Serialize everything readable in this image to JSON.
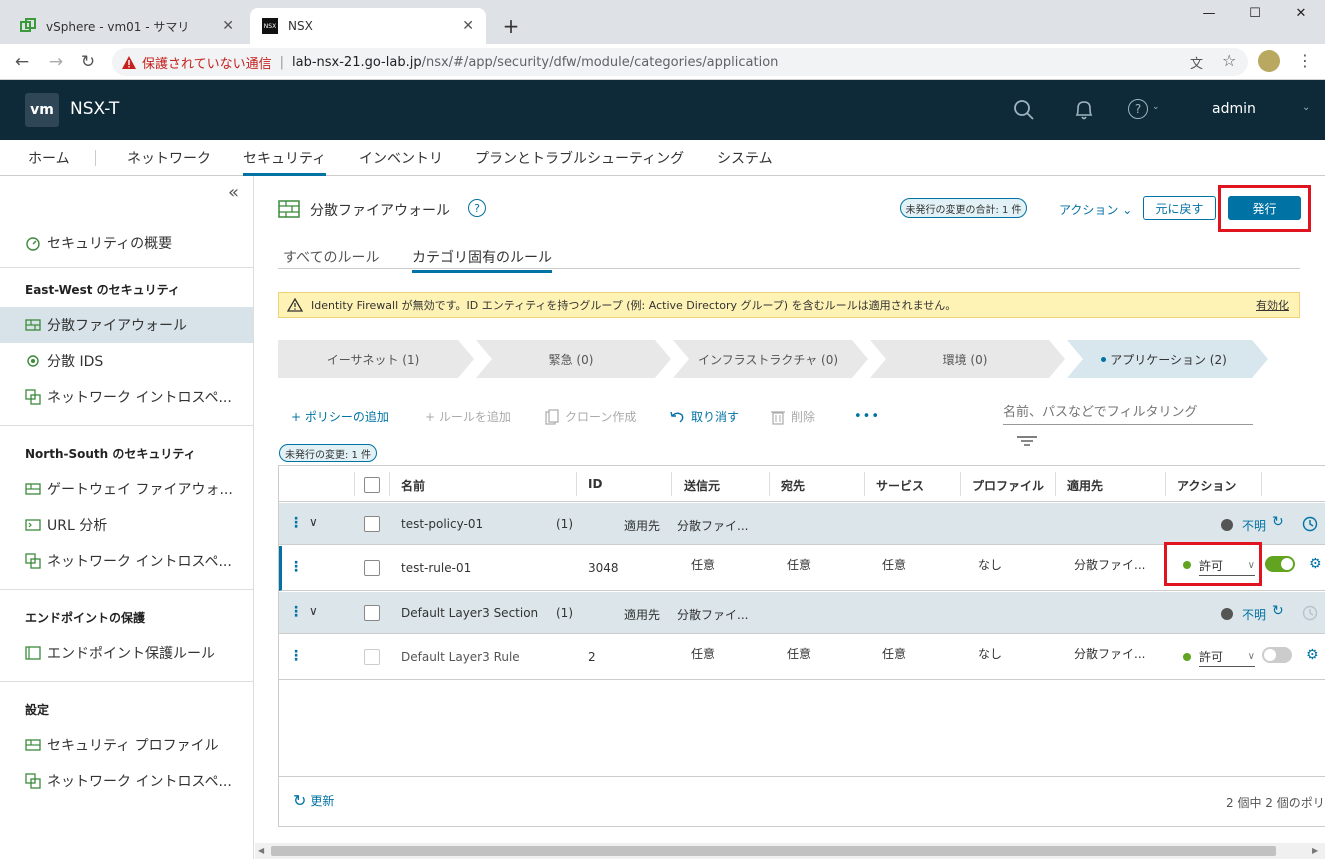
{
  "browser": {
    "tabs": [
      {
        "title": "vSphere - vm01 - サマリ",
        "active": false
      },
      {
        "title": "NSX",
        "active": true
      }
    ],
    "security_warning": "保護されていない通信",
    "url_host": "lab-nsx-21.go-lab.jp",
    "url_path": "/nsx/#/app/security/dfw/module/categories/application"
  },
  "header": {
    "logo": "vm",
    "title": "NSX-T",
    "user": "admin"
  },
  "main_nav": [
    "ホーム",
    "ネットワーク",
    "セキュリティ",
    "インベントリ",
    "プランとトラブルシューティング",
    "システム"
  ],
  "sidebar": {
    "collapse": "«",
    "overview": "セキュリティの概要",
    "east_west_heading": "East-West のセキュリティ",
    "east_west_items": [
      "分散ファイアウォール",
      "分散 IDS",
      "ネットワーク イントロスペ..."
    ],
    "north_south_heading": "North-South のセキュリティ",
    "north_south_items": [
      "ゲートウェイ ファイアウォ...",
      "URL 分析",
      "ネットワーク イントロスペ..."
    ],
    "endpoint_heading": "エンドポイントの保護",
    "endpoint_items": [
      "エンドポイント保護ルール"
    ],
    "settings_heading": "設定",
    "settings_items": [
      "セキュリティ プロファイル",
      "ネットワーク イントロスペ..."
    ]
  },
  "page": {
    "title": "分散ファイアウォール",
    "help": "?",
    "unpublished_total": "未発行の変更の合計: 1 件",
    "actions": "アクション",
    "revert": "元に戻す",
    "publish": "発行",
    "tabs": [
      "すべてのルール",
      "カテゴリ固有のルール"
    ],
    "alert_text": "Identity Firewall が無効です。ID エンティティを持つグループ (例: Active Directory グループ) を含むルールは適用されません。",
    "alert_link": "有効化",
    "categories": [
      "イーサネット (1)",
      "緊急 (0)",
      "インフラストラクチャ (0)",
      "環境 (0)",
      "アプリケーション (2)"
    ],
    "toolbar": {
      "add_policy": "+ ポリシーの追加",
      "add_rule": "+ ルールを追加",
      "clone": "クローン作成",
      "undo": "取り消す",
      "delete": "削除",
      "more": "•••",
      "filter_placeholder": "名前、パスなどでフィルタリング"
    },
    "unpublished_badge": "未発行の変更: 1 件",
    "columns": [
      "名前",
      "ID",
      "送信元",
      "宛先",
      "サービス",
      "プロファイル",
      "適用先",
      "アクション"
    ],
    "policies": [
      {
        "name": "test-policy-01",
        "count": "(1)",
        "applied_label": "適用先",
        "applied_to": "分散ファイ...",
        "status": "不明",
        "rule": {
          "name": "test-rule-01",
          "id": "3048",
          "source": "任意",
          "destination": "任意",
          "service": "任意",
          "profile": "なし",
          "applied_to": "分散ファイ...",
          "action": "許可",
          "enabled": true
        }
      },
      {
        "name": "Default Layer3 Section",
        "count": "(1)",
        "applied_label": "適用先",
        "applied_to": "分散ファイ...",
        "status": "不明",
        "rule": {
          "name": "Default Layer3 Rule",
          "id": "2",
          "source": "任意",
          "destination": "任意",
          "service": "任意",
          "profile": "なし",
          "applied_to": "分散ファイ...",
          "action": "許可",
          "enabled": false
        }
      }
    ],
    "refresh": "更新",
    "pagination": "2 個中 2 個のポリ"
  },
  "colors": {
    "header_bg": "#0e2a38",
    "accent": "#0072a3",
    "highlight_box": "#e0141e",
    "allow_green": "#62a420"
  }
}
